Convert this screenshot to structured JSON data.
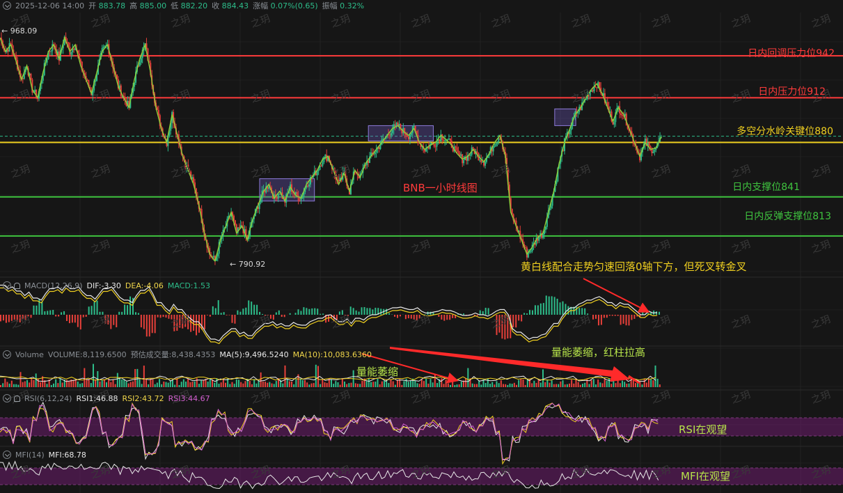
{
  "header": {
    "timestamp": "2025-12-06 14:00",
    "open_label": "开",
    "open": "883.78",
    "high_label": "高",
    "high": "885.00",
    "low_label": "低",
    "low": "882.20",
    "close_label": "收",
    "close": "884.43",
    "change_label": "涨幅",
    "change": "0.07%(0.65)",
    "amplitude_label": "振幅",
    "amplitude": "0.32%"
  },
  "price_markers": {
    "high": "968.09",
    "low": "790.92"
  },
  "levels": [
    {
      "label": "日内回调压力位942",
      "value": 942,
      "color": "#ff3b3b",
      "text_color": "#ff3b3b"
    },
    {
      "label": "日内压力位912",
      "value": 912,
      "color": "#ff3b3b",
      "text_color": "#ff3b3b"
    },
    {
      "label": "多空分水岭关键位880",
      "value": 880,
      "color": "#f0d020",
      "text_color": "#f0d020"
    },
    {
      "label": "日内支撑位841",
      "value": 841,
      "color": "#3fc43f",
      "text_color": "#3fc43f"
    },
    {
      "label": "日内反弹支撑位813",
      "value": 813,
      "color": "#3fc43f",
      "text_color": "#3fc43f"
    }
  ],
  "annotations": {
    "chart_title": "BNB一小时线图",
    "macd_note": "黄白线配合走势匀速回落0轴下方，但死叉转金叉",
    "volume_note_1": "量能萎缩",
    "volume_note_2": "量能萎缩，红柱拉高",
    "rsi_note": "RSI在观望",
    "mfi_note": "MFI在观望"
  },
  "macd_header": {
    "name": "MACD(12,26,9)",
    "dif": "DIF:-3.30",
    "dea": "DEA:-4.06",
    "macd": "MACD:1.53"
  },
  "volume_header": {
    "name": "Volume",
    "volume": "VOLUME:8,119.6500",
    "est": "预估成交量:8,438.4353",
    "ma5": "MA(5):9,496.5240",
    "ma10": "MA(10):10,083.6360"
  },
  "rsi_header": {
    "name": "RSI(6,12,24)",
    "rsi1": "RSI1:46.88",
    "rsi2": "RSI2:43.72",
    "rsi3": "RSI3:44.67"
  },
  "mfi_header": {
    "name": "MFI(14)",
    "mfi": "MFI:68.78"
  },
  "watermark": "之玥",
  "colors": {
    "up": "#2dbd8a",
    "down": "#e8403a",
    "price_line": "#8fd13a",
    "box": "#5a4a9a",
    "band": "#5a1a5a",
    "arrow": "#ff2a2a",
    "annotation_green": "#b6e34a",
    "annotation_yellow": "#f0d020"
  },
  "chart_data": [
    {
      "type": "candlestick",
      "title": "BNB一小时线图",
      "ylim": [
        785,
        972
      ],
      "y_markers": {
        "high": 968.09,
        "low": 790.92
      },
      "close_path": [
        955,
        945,
        950,
        938,
        925,
        935,
        918,
        912,
        930,
        945,
        950,
        940,
        955,
        945,
        950,
        935,
        925,
        915,
        930,
        945,
        950,
        935,
        920,
        912,
        905,
        925,
        940,
        950,
        930,
        905,
        890,
        880,
        900,
        885,
        870,
        860,
        850,
        835,
        815,
        800,
        795,
        810,
        820,
        830,
        815,
        820,
        810,
        825,
        835,
        845,
        850,
        840,
        845,
        838,
        848,
        842,
        840,
        850,
        855,
        860,
        868,
        870,
        860,
        850,
        858,
        845,
        860,
        855,
        865,
        870,
        875,
        880,
        885,
        890,
        892,
        888,
        885,
        890,
        880,
        875,
        878,
        880,
        885,
        882,
        878,
        872,
        868,
        870,
        875,
        870,
        866,
        872,
        880,
        885,
        870,
        830,
        820,
        810,
        800,
        805,
        812,
        815,
        830,
        845,
        865,
        880,
        890,
        900,
        905,
        912,
        918,
        922,
        915,
        905,
        895,
        905,
        900,
        890,
        880,
        870,
        880,
        875,
        876,
        884
      ],
      "boxes": [
        {
          "x": [
            0.308,
            0.373
          ],
          "y": [
            838,
            854
          ]
        },
        {
          "x": [
            0.437,
            0.514
          ],
          "y": [
            881,
            892
          ]
        },
        {
          "x": [
            0.658,
            0.683
          ],
          "y": [
            892,
            904
          ]
        }
      ]
    },
    {
      "type": "bar",
      "name": "MACD",
      "values": {
        "DIF": -3.3,
        "DEA": -4.06,
        "MACD": 1.53
      }
    },
    {
      "type": "bar",
      "name": "Volume",
      "values": {
        "VOLUME": 8119.65,
        "预估成交量": 8438.4353,
        "MA(5)": 9496.524,
        "MA(10)": 10083.636
      }
    },
    {
      "type": "line",
      "name": "RSI(6,12,24)",
      "values": {
        "RSI1": 46.88,
        "RSI2": 43.72,
        "RSI3": 44.67
      }
    },
    {
      "type": "line",
      "name": "MFI(14)",
      "values": {
        "MFI": 68.78
      }
    }
  ]
}
